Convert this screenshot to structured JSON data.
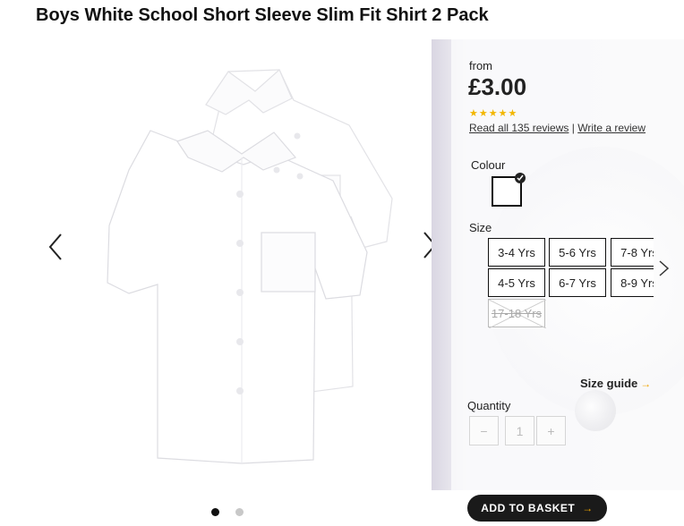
{
  "product": {
    "title": "Boys White School Short Sleeve Slim Fit Shirt 2 Pack",
    "price_prefix": "from",
    "price": "£3.00",
    "rating": {
      "stars": "★★★★★",
      "value": 5,
      "max": 5
    },
    "reviews_link": "Read all 135 reviews",
    "separator": "|",
    "write_review_link": "Write a review"
  },
  "gallery": {
    "image_count": 2,
    "active_index": 0,
    "prev_icon": "chevron-left-icon",
    "next_icon": "chevron-right-icon"
  },
  "options": {
    "colour_label": "Colour",
    "colour_selected": "#ffffff",
    "size_label": "Size",
    "sizes": [
      "3-4 Yrs",
      "5-6 Yrs",
      "7-8 Yrs",
      "4-5 Yrs",
      "6-7 Yrs",
      "8-9 Yrs"
    ],
    "sizes_unavailable": [
      "17-18 Yrs"
    ],
    "size_guide": "Size guide",
    "size_guide_arrow": "→"
  },
  "quantity": {
    "label": "Quantity",
    "minus": "−",
    "value": "1",
    "plus": "+"
  },
  "actions": {
    "add_to_basket": "ADD TO BASKET",
    "add_to_basket_arrow": "→"
  },
  "colors": {
    "accent_arrow": "#f0a500",
    "star": "#f2b600",
    "button_bg": "#1a1a1a"
  }
}
